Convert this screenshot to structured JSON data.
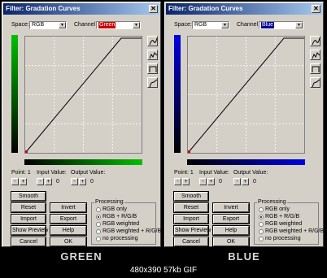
{
  "footer": "480x390  57kb  GIF",
  "panels": [
    {
      "title": "Filter: Gradation Curves",
      "space_label": "Space:",
      "space_value": "RGB",
      "channel_label": "Channel",
      "channel_value": "Green",
      "channel_color": "#cc0000",
      "bar_color": "#00c000",
      "point_label": "Point: 1",
      "input_label": "Input Value:",
      "output_label": "Output Value:",
      "input_value": "0",
      "output_value": "0",
      "buttons": {
        "smooth": "Smooth",
        "reset": "Reset",
        "invert": "Invert",
        "import": "Import",
        "export": "Export",
        "show_preview": "Show Preview",
        "help": "Help",
        "cancel": "Cancel",
        "ok": "OK"
      },
      "processing_title": "Processing",
      "processing_options": [
        "RGB only",
        "RGB + R/G/B",
        "RGB weighted",
        "RGB weighted + R/G/B",
        "no processing"
      ],
      "processing_selected": 1,
      "caption": "GREEN"
    },
    {
      "title": "Filter: Gradation Curves",
      "space_label": "Space:",
      "space_value": "RGB",
      "channel_label": "Channel",
      "channel_value": "Blue",
      "channel_color": "#000099",
      "bar_color": "#0000e0",
      "point_label": "Point: 1",
      "input_label": "Input Value:",
      "output_label": "Output Value:",
      "input_value": "0",
      "output_value": "0",
      "buttons": {
        "smooth": "Smooth",
        "reset": "Reset",
        "invert": "Invert",
        "import": "Import",
        "export": "Export",
        "show_preview": "Show Preview",
        "help": "Help",
        "cancel": "Cancel",
        "ok": "OK"
      },
      "processing_title": "Processing",
      "processing_options": [
        "RGB only",
        "RGB + R/G/B",
        "RGB weighted",
        "RGB weighted + R/G/B",
        "no processing"
      ],
      "processing_selected": 1,
      "caption": "BLUE"
    }
  ],
  "icons": {
    "close": "close-icon",
    "tools": [
      "spline-curve-tool-icon",
      "freehand-curve-tool-icon",
      "smooth-curve-tool-icon",
      "linear-curve-tool-icon"
    ]
  }
}
